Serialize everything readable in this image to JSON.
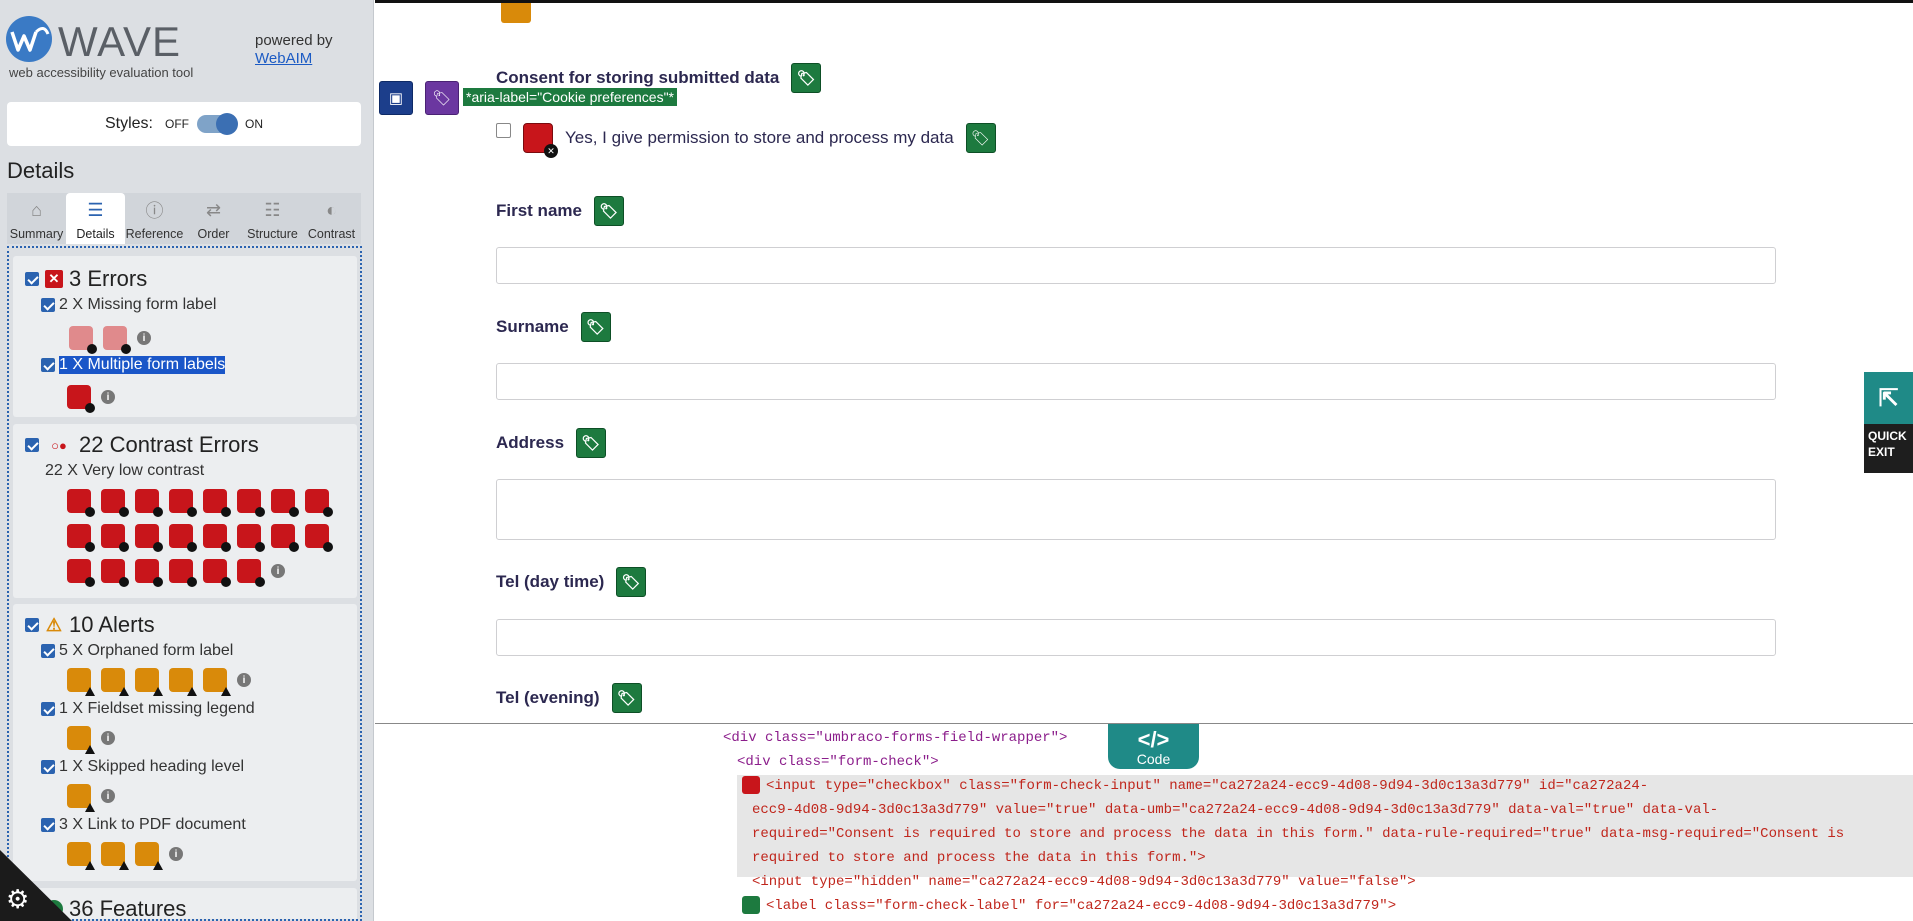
{
  "wave": {
    "title": "WAVE",
    "subtitle": "web accessibility evaluation tool",
    "powered_by": "powered by",
    "powered_link": "WebAIM",
    "styles_label": "Styles:",
    "styles_off": "OFF",
    "styles_on": "ON",
    "styles_state": "on",
    "details_heading": "Details",
    "tabs": [
      {
        "label": "Summary",
        "icon": "home-icon"
      },
      {
        "label": "Details",
        "icon": "list-icon",
        "active": true
      },
      {
        "label": "Reference",
        "icon": "info-icon"
      },
      {
        "label": "Order",
        "icon": "order-icon"
      },
      {
        "label": "Structure",
        "icon": "structure-icon"
      },
      {
        "label": "Contrast",
        "icon": "contrast-icon"
      }
    ],
    "errors": {
      "heading": "3 Errors",
      "items": [
        {
          "label": "2 X Missing form label",
          "count": 2
        },
        {
          "label": "1 X Multiple form labels",
          "count": 1
        }
      ]
    },
    "contrast": {
      "heading": "22 Contrast Errors",
      "items": [
        {
          "label": "22 X Very low contrast",
          "count": 22
        }
      ]
    },
    "alerts": {
      "heading": "10 Alerts",
      "items": [
        {
          "label": "5 X Orphaned form label",
          "count": 5
        },
        {
          "label": "1 X Fieldset missing legend",
          "count": 1
        },
        {
          "label": "1 X Skipped heading level",
          "count": 1
        },
        {
          "label": "3 X Link to PDF document",
          "count": 3
        }
      ]
    },
    "features": {
      "heading": "36 Features"
    }
  },
  "form": {
    "consent_heading": "Consent for storing submitted data",
    "aria_label_text": "*aria-label=\"Cookie preferences\"*",
    "consent_checkbox_label": "Yes, I give permission to store and process my data",
    "fields": [
      {
        "label": "First name"
      },
      {
        "label": "Surname"
      },
      {
        "label": "Address"
      },
      {
        "label": "Tel (day time)"
      },
      {
        "label": "Tel (evening)"
      }
    ],
    "quick_exit": "QUICK EXIT"
  },
  "code": {
    "button_label": "Code",
    "button_glyph": "</>",
    "line1": "<div class=\"umbraco-forms-field-wrapper\">",
    "line2": "<div class=\"form-check\">",
    "line3a": "<input type=\"checkbox\" class=\"form-check-input\" name=\"ca272a24-ecc9-4d08-9d94-3d0c13a3d779\" id=\"ca272a24-",
    "line3b": "ecc9-4d08-9d94-3d0c13a3d779\" value=\"true\" data-umb=\"ca272a24-ecc9-4d08-9d94-3d0c13a3d779\" data-val=\"true\" data-val-",
    "line3c": "required=\"Consent is required to store and process the data in this form.\" data-rule-required=\"true\" data-msg-required=\"Consent is",
    "line3d": "required to store and process the data in this form.\">",
    "line4": "<input type=\"hidden\" name=\"ca272a24-ecc9-4d08-9d94-3d0c13a3d779\" value=\"false\">",
    "line5": "<label class=\"form-check-label\" for=\"ca272a24-ecc9-4d08-9d94-3d0c13a3d779\">"
  },
  "colors": {
    "error": "#c8151b",
    "alert": "#d98a0a",
    "feature": "#1d7a3f",
    "accent": "#2b63b0"
  }
}
